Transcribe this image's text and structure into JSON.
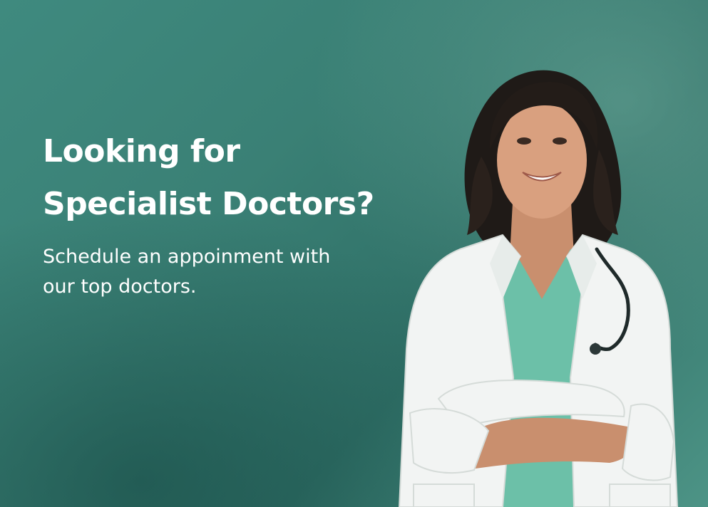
{
  "hero": {
    "headline_line1": "Looking for",
    "headline_line2": "Specialist Doctors?",
    "subline_line1": "Schedule an appoinment with",
    "subline_line2": "our top doctors."
  },
  "colors": {
    "background_teal": "#3a8075",
    "text": "#ffffff",
    "coat": "#f2f4f3",
    "scrubs": "#6cc0a8"
  },
  "image": {
    "subject": "smiling female doctor in white coat with stethoscope, arms crossed"
  }
}
